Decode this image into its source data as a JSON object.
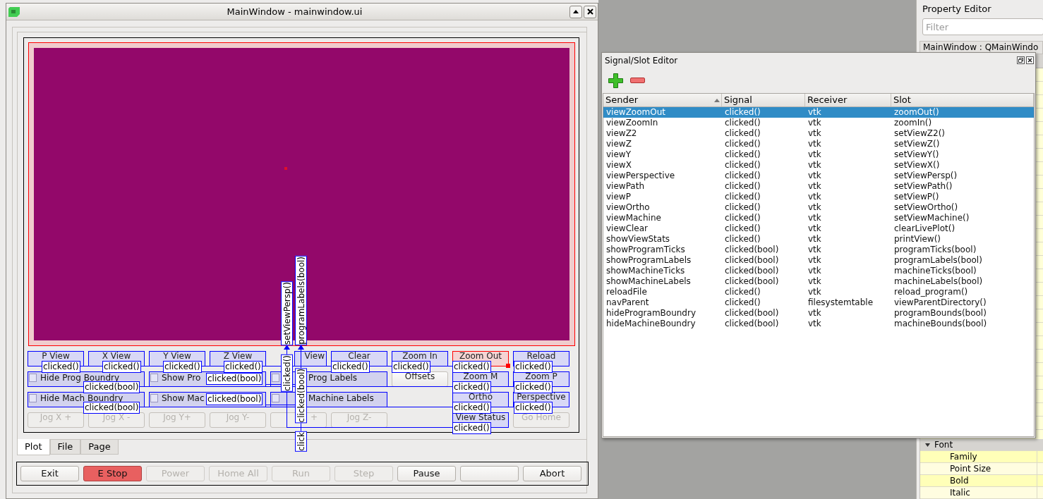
{
  "main_window": {
    "title": "MainWindow - mainwindow.ui"
  },
  "form_rows": [
    [
      {
        "kind": "button",
        "label": "P View",
        "connected": true,
        "selected": false,
        "disabled": false
      },
      {
        "kind": "button",
        "label": "X View",
        "connected": true,
        "selected": false,
        "disabled": false
      },
      {
        "kind": "button",
        "label": "Y View",
        "connected": true,
        "selected": false,
        "disabled": false
      },
      {
        "kind": "button",
        "label": "Z View",
        "connected": true,
        "selected": false,
        "disabled": false
      },
      {
        "kind": "button",
        "label": "View",
        "connected": true,
        "selected": false,
        "disabled": false
      },
      {
        "kind": "button",
        "label": "Clear",
        "connected": true,
        "selected": false,
        "disabled": false
      },
      {
        "kind": "button",
        "label": "Zoom In",
        "connected": true,
        "selected": false,
        "disabled": false
      },
      {
        "kind": "button",
        "label": "Zoom Out",
        "selected": true,
        "disabled": false
      },
      {
        "kind": "button",
        "label": "Reload",
        "connected": true,
        "selected": false,
        "disabled": false
      }
    ],
    [
      {
        "kind": "checkbox",
        "label": "Hide Prog Boundry",
        "checked": false
      },
      {
        "kind": "checkbox",
        "label": "Show Pro",
        "checked": false
      },
      {
        "kind": "checkbox",
        "label": "Prog Labels",
        "checked": false
      },
      {
        "kind": "button",
        "label": "Offsets",
        "connected": false,
        "selected": false,
        "disabled": false
      },
      {
        "kind": "button",
        "label": "Zoom M",
        "connected": true,
        "selected": false,
        "disabled": false
      },
      {
        "kind": "button",
        "label": "Zoom P",
        "connected": true,
        "selected": false,
        "disabled": false
      }
    ],
    [
      {
        "kind": "checkbox",
        "label": "Hide Mach Boundry",
        "checked": false
      },
      {
        "kind": "checkbox",
        "label": "Show Mac",
        "checked": false
      },
      {
        "kind": "checkbox",
        "label": "Machine Labels",
        "checked": false
      },
      {
        "kind": "button",
        "label": "Ortho",
        "connected": true,
        "selected": false,
        "disabled": false
      },
      {
        "kind": "button",
        "label": "Perspective",
        "connected": true,
        "selected": false,
        "disabled": false
      }
    ],
    [
      {
        "kind": "button",
        "label": "Jog X +",
        "connected": false,
        "selected": false,
        "disabled": true
      },
      {
        "kind": "button",
        "label": "Jog X -",
        "connected": false,
        "selected": false,
        "disabled": true
      },
      {
        "kind": "button",
        "label": "Jog Y+",
        "connected": false,
        "selected": false,
        "disabled": true
      },
      {
        "kind": "button",
        "label": "Jog Y-",
        "connected": false,
        "selected": false,
        "disabled": true
      },
      {
        "kind": "button",
        "label": "+",
        "connected": false,
        "selected": false,
        "disabled": true
      },
      {
        "kind": "button",
        "label": "Jog Z-",
        "connected": false,
        "selected": false,
        "disabled": true
      },
      {
        "kind": "button",
        "label": "View Status",
        "connected": true,
        "selected": false,
        "disabled": false
      },
      {
        "kind": "button",
        "label": "Go Home",
        "connected": false,
        "selected": false,
        "disabled": true
      }
    ]
  ],
  "connection_labels": [
    {
      "text": "setViewPersp()"
    },
    {
      "text": "programLabels(bool)"
    },
    {
      "text": "clicked()"
    },
    {
      "text": "clicked()"
    },
    {
      "text": "clicked()"
    },
    {
      "text": "clicked()"
    },
    {
      "text": "clicked()"
    },
    {
      "text": "clicked()"
    },
    {
      "text": "clicked()"
    },
    {
      "text": "clicked()"
    },
    {
      "text": "clicked()"
    },
    {
      "text": "clicked(bool)"
    },
    {
      "text": "clicked(bool)"
    },
    {
      "text": "clicked()"
    },
    {
      "text": "clicked()"
    },
    {
      "text": "clicked(bool)"
    },
    {
      "text": "clicked(bool)"
    },
    {
      "text": "clicked()"
    },
    {
      "text": "clicked()"
    },
    {
      "text": "clicked(bool)"
    },
    {
      "text": "clicked()"
    },
    {
      "text": "click"
    }
  ],
  "tabs": [
    {
      "label": "Plot",
      "selected": true
    },
    {
      "label": "File",
      "selected": false
    },
    {
      "label": "Page",
      "selected": false
    }
  ],
  "control_buttons": [
    {
      "label": "Exit",
      "kind": "normal",
      "disabled": false
    },
    {
      "label": "E Stop",
      "kind": "danger",
      "disabled": false
    },
    {
      "label": "Power",
      "kind": "normal",
      "disabled": true
    },
    {
      "label": "Home All",
      "kind": "normal",
      "disabled": true
    },
    {
      "label": "Run",
      "kind": "normal",
      "disabled": true
    },
    {
      "label": "Step",
      "kind": "normal",
      "disabled": true
    },
    {
      "label": "Pause",
      "kind": "normal",
      "disabled": false
    },
    {
      "kind": "normal",
      "disabled": false
    },
    {
      "label": "Abort",
      "kind": "normal",
      "disabled": false
    }
  ],
  "signal_slot_editor": {
    "title": "Signal/Slot Editor",
    "columns": [
      "Sender",
      "Signal",
      "Receiver",
      "Slot"
    ],
    "rows": [
      {
        "sender": "viewZoomOut",
        "signal": "clicked()",
        "receiver": "vtk",
        "slot": "zoomOut()",
        "selected": true
      },
      {
        "sender": "viewZoomIn",
        "signal": "clicked()",
        "receiver": "vtk",
        "slot": "zoomIn()",
        "selected": false
      },
      {
        "sender": "viewZ2",
        "signal": "clicked()",
        "receiver": "vtk",
        "slot": "setViewZ2()",
        "selected": false
      },
      {
        "sender": "viewZ",
        "signal": "clicked()",
        "receiver": "vtk",
        "slot": "setViewZ()",
        "selected": false
      },
      {
        "sender": "viewY",
        "signal": "clicked()",
        "receiver": "vtk",
        "slot": "setViewY()",
        "selected": false
      },
      {
        "sender": "viewX",
        "signal": "clicked()",
        "receiver": "vtk",
        "slot": "setViewX()",
        "selected": false
      },
      {
        "sender": "viewPerspective",
        "signal": "clicked()",
        "receiver": "vtk",
        "slot": "setViewPersp()",
        "selected": false
      },
      {
        "sender": "viewPath",
        "signal": "clicked()",
        "receiver": "vtk",
        "slot": "setViewPath()",
        "selected": false
      },
      {
        "sender": "viewP",
        "signal": "clicked()",
        "receiver": "vtk",
        "slot": "setViewP()",
        "selected": false
      },
      {
        "sender": "viewOrtho",
        "signal": "clicked()",
        "receiver": "vtk",
        "slot": "setViewOrtho()",
        "selected": false
      },
      {
        "sender": "viewMachine",
        "signal": "clicked()",
        "receiver": "vtk",
        "slot": "setViewMachine()",
        "selected": false
      },
      {
        "sender": "viewClear",
        "signal": "clicked()",
        "receiver": "vtk",
        "slot": "clearLivePlot()",
        "selected": false
      },
      {
        "sender": "showViewStats",
        "signal": "clicked()",
        "receiver": "vtk",
        "slot": "printView()",
        "selected": false
      },
      {
        "sender": "showProgramTicks",
        "signal": "clicked(bool)",
        "receiver": "vtk",
        "slot": "programTicks(bool)",
        "selected": false
      },
      {
        "sender": "showProgramLabels",
        "signal": "clicked(bool)",
        "receiver": "vtk",
        "slot": "programLabels(bool)",
        "selected": false
      },
      {
        "sender": "showMachineTicks",
        "signal": "clicked(bool)",
        "receiver": "vtk",
        "slot": "machineTicks(bool)",
        "selected": false
      },
      {
        "sender": "showMachineLabels",
        "signal": "clicked(bool)",
        "receiver": "vtk",
        "slot": "machineLabels(bool)",
        "selected": false
      },
      {
        "sender": "reloadFile",
        "signal": "clicked()",
        "receiver": "vtk",
        "slot": "reload_program()",
        "selected": false
      },
      {
        "sender": "navParent",
        "signal": "clicked()",
        "receiver": "filesystemtable",
        "slot": "viewParentDirectory()",
        "selected": false
      },
      {
        "sender": "hideProgramBoundry",
        "signal": "clicked(bool)",
        "receiver": "vtk",
        "slot": "programBounds(bool)",
        "selected": false
      },
      {
        "sender": "hideMachineBoundry",
        "signal": "clicked(bool)",
        "receiver": "vtk",
        "slot": "machineBounds(bool)",
        "selected": false
      }
    ]
  },
  "property_editor": {
    "title": "Property Editor",
    "filter_placeholder": "Filter",
    "object": "MainWindow : QMainWindo",
    "properties": [
      {
        "name": "Font",
        "kind": "group",
        "expanded": true
      },
      {
        "name": "Family",
        "kind": "item"
      },
      {
        "name": "Point Size",
        "kind": "item"
      },
      {
        "name": "Bold",
        "kind": "item"
      },
      {
        "name": "Italic",
        "kind": "item"
      }
    ]
  }
}
